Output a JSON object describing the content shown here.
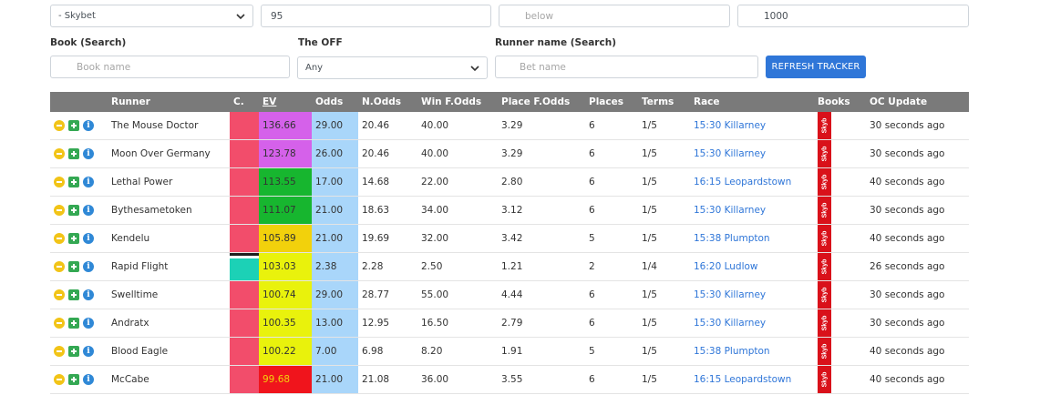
{
  "filters": {
    "bookmaker_select": {
      "selected": "- Skybet"
    },
    "min_value": {
      "value": "95"
    },
    "below_field": {
      "value": "",
      "placeholder": "below"
    },
    "max_value": {
      "value": "1000"
    },
    "book_search": {
      "label": "Book (Search)",
      "placeholder": "Book name"
    },
    "the_off": {
      "label": "The OFF",
      "selected": "Any"
    },
    "runner_search": {
      "label": "Runner name (Search)",
      "placeholder": "Bet name"
    },
    "refresh_label": "REFRESH TRACKER"
  },
  "table": {
    "headers": {
      "runner": "Runner",
      "c": "C.",
      "ev": "EV",
      "odds": "Odds",
      "n_odds": "N.Odds",
      "win_f_odds": "Win F.Odds",
      "place_f_odds": "Place F.Odds",
      "places": "Places",
      "terms": "Terms",
      "race": "Race",
      "books": "Books",
      "oc_update": "OC Update"
    },
    "rows": [
      {
        "runner": "The Mouse Doctor",
        "ev": "136.66",
        "odds": "29.00",
        "n_odds": "20.46",
        "win_f_odds": "40.00",
        "place_f_odds": "3.29",
        "places": "6",
        "terms": "1/5",
        "race": "15:30 Killarney",
        "book": "Skyb",
        "oc_update": "30 seconds ago",
        "ev_color": "#d561ea",
        "c_color": "#f24d6b"
      },
      {
        "runner": "Moon Over Germany",
        "ev": "123.78",
        "odds": "26.00",
        "n_odds": "20.46",
        "win_f_odds": "40.00",
        "place_f_odds": "3.29",
        "places": "6",
        "terms": "1/5",
        "race": "15:30 Killarney",
        "book": "Skyb",
        "oc_update": "30 seconds ago",
        "ev_color": "#d561ea",
        "c_color": "#f24d6b"
      },
      {
        "runner": "Lethal Power",
        "ev": "113.55",
        "odds": "17.00",
        "n_odds": "14.68",
        "win_f_odds": "22.00",
        "place_f_odds": "2.80",
        "places": "6",
        "terms": "1/5",
        "race": "16:15 Leopardstown",
        "book": "Skyb",
        "oc_update": "40 seconds ago",
        "ev_color": "#17b62f",
        "c_color": "#f24d6b"
      },
      {
        "runner": "Bythesametoken",
        "ev": "111.07",
        "odds": "21.00",
        "n_odds": "18.63",
        "win_f_odds": "34.00",
        "place_f_odds": "3.12",
        "places": "6",
        "terms": "1/5",
        "race": "15:30 Killarney",
        "book": "Skyb",
        "oc_update": "30 seconds ago",
        "ev_color": "#17b62f",
        "c_color": "#f24d6b"
      },
      {
        "runner": "Kendelu",
        "ev": "105.89",
        "odds": "21.00",
        "n_odds": "19.69",
        "win_f_odds": "32.00",
        "place_f_odds": "3.42",
        "places": "5",
        "terms": "1/5",
        "race": "15:38 Plumpton",
        "book": "Skyb",
        "oc_update": "40 seconds ago",
        "ev_color": "#f2d10c",
        "c_color": "#f24d6b"
      },
      {
        "runner": "Rapid Flight",
        "ev": "103.03",
        "odds": "2.38",
        "n_odds": "2.28",
        "win_f_odds": "2.50",
        "place_f_odds": "1.21",
        "places": "2",
        "terms": "1/4",
        "race": "16:20 Ludlow",
        "book": "Skyb",
        "oc_update": "26 seconds ago",
        "ev_color": "#e9f20c",
        "c_color": "#1cd1b6"
      },
      {
        "runner": "Swelltime",
        "ev": "100.74",
        "odds": "29.00",
        "n_odds": "28.77",
        "win_f_odds": "55.00",
        "place_f_odds": "4.44",
        "places": "6",
        "terms": "1/5",
        "race": "15:30 Killarney",
        "book": "Skyb",
        "oc_update": "30 seconds ago",
        "ev_color": "#e9f20c",
        "c_color": "#f24d6b"
      },
      {
        "runner": "Andratx",
        "ev": "100.35",
        "odds": "13.00",
        "n_odds": "12.95",
        "win_f_odds": "16.50",
        "place_f_odds": "2.79",
        "places": "6",
        "terms": "1/5",
        "race": "15:30 Killarney",
        "book": "Skyb",
        "oc_update": "30 seconds ago",
        "ev_color": "#e9f20c",
        "c_color": "#f24d6b"
      },
      {
        "runner": "Blood Eagle",
        "ev": "100.22",
        "odds": "7.00",
        "n_odds": "6.98",
        "win_f_odds": "8.20",
        "place_f_odds": "1.91",
        "places": "5",
        "terms": "1/5",
        "race": "15:38 Plumpton",
        "book": "Skyb",
        "oc_update": "40 seconds ago",
        "ev_color": "#e9f20c",
        "c_color": "#f24d6b"
      },
      {
        "runner": "McCabe",
        "ev": "99.68",
        "odds": "21.00",
        "n_odds": "21.08",
        "win_f_odds": "36.00",
        "place_f_odds": "3.55",
        "places": "6",
        "terms": "1/5",
        "race": "16:15 Leopardstown",
        "book": "Skyb",
        "oc_update": "40 seconds ago",
        "ev_color": "#f0141c",
        "ev_text_color": "#f2d10c",
        "c_color": "#f24d6b"
      }
    ]
  }
}
